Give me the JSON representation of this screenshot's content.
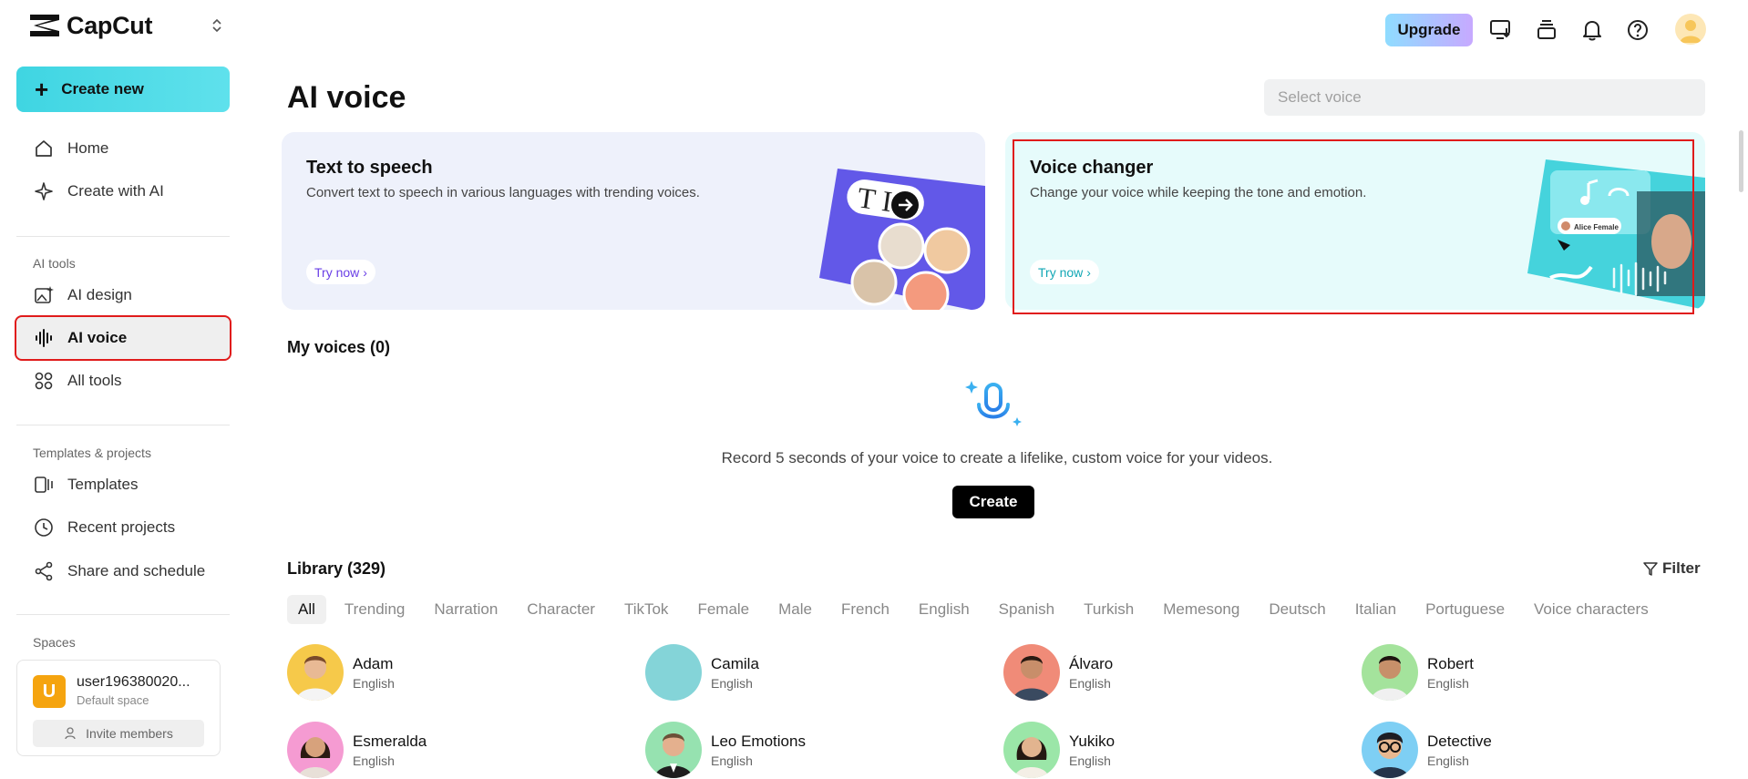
{
  "app": {
    "name": "CapCut"
  },
  "sidebar": {
    "create_new": "Create new",
    "nav_main": [
      {
        "id": "home",
        "label": "Home",
        "icon": "home-icon"
      },
      {
        "id": "create-with-ai",
        "label": "Create with AI",
        "icon": "sparkle-icon"
      }
    ],
    "ai_tools_label": "AI tools",
    "ai_tools": [
      {
        "id": "ai-design",
        "label": "AI design",
        "icon": "image-sparkle-icon"
      },
      {
        "id": "ai-voice",
        "label": "AI voice",
        "icon": "waveform-icon",
        "active": true
      },
      {
        "id": "all-tools",
        "label": "All tools",
        "icon": "grid-icon"
      }
    ],
    "templates_label": "Templates & projects",
    "templates": [
      {
        "id": "templates",
        "label": "Templates",
        "icon": "template-icon"
      },
      {
        "id": "recent-projects",
        "label": "Recent projects",
        "icon": "clock-icon"
      },
      {
        "id": "share-and-schedule",
        "label": "Share and schedule",
        "icon": "share-icon"
      }
    ],
    "spaces_label": "Spaces",
    "space": {
      "initial": "U",
      "name": "user196380020...",
      "subtitle": "Default space",
      "invite": "Invite members"
    }
  },
  "topbar": {
    "upgrade": "Upgrade",
    "icons": [
      "desktop-download-icon",
      "layers-icon",
      "bell-icon",
      "help-icon"
    ]
  },
  "main": {
    "title": "AI voice",
    "select_voice_placeholder": "Select voice",
    "cards": {
      "tts": {
        "title": "Text to speech",
        "desc": "Convert text to speech in various languages with trending voices.",
        "cta": "Try now"
      },
      "vc": {
        "title": "Voice changer",
        "desc": "Change your voice while keeping the tone and emotion.",
        "cta": "Try now",
        "art_label": "Alice Female"
      }
    },
    "my_voices": "My voices (0)",
    "record_text": "Record 5 seconds of your voice to create a lifelike, custom voice for your videos.",
    "create": "Create",
    "library_title": "Library (329)",
    "filter": "Filter",
    "chips": [
      "All",
      "Trending",
      "Narration",
      "Character",
      "TikTok",
      "Female",
      "Male",
      "French",
      "English",
      "Spanish",
      "Turkish",
      "Memesong",
      "Deutsch",
      "Italian",
      "Portuguese",
      "Voice characters"
    ],
    "voices": [
      {
        "name": "Adam",
        "lang": "English",
        "bg": "#f6c94a"
      },
      {
        "name": "Camila",
        "lang": "English",
        "bg": "#84d4d8"
      },
      {
        "name": "Álvaro",
        "lang": "English",
        "bg": "#f08b78"
      },
      {
        "name": "Robert",
        "lang": "English",
        "bg": "#a4e39c"
      },
      {
        "name": "Esmeralda",
        "lang": "English",
        "bg": "#f59bd2"
      },
      {
        "name": "Leo Emotions",
        "lang": "English",
        "bg": "#96e2b0"
      },
      {
        "name": "Yukiko",
        "lang": "English",
        "bg": "#9be6a8"
      },
      {
        "name": "Detective",
        "lang": "English",
        "bg": "#7ecff4"
      }
    ]
  },
  "colors": {
    "accent_cyan": "#3fd5e2",
    "highlight_red": "#e01b1b",
    "tts_cta": "#6a3fe6",
    "vc_cta": "#12a7b5"
  }
}
